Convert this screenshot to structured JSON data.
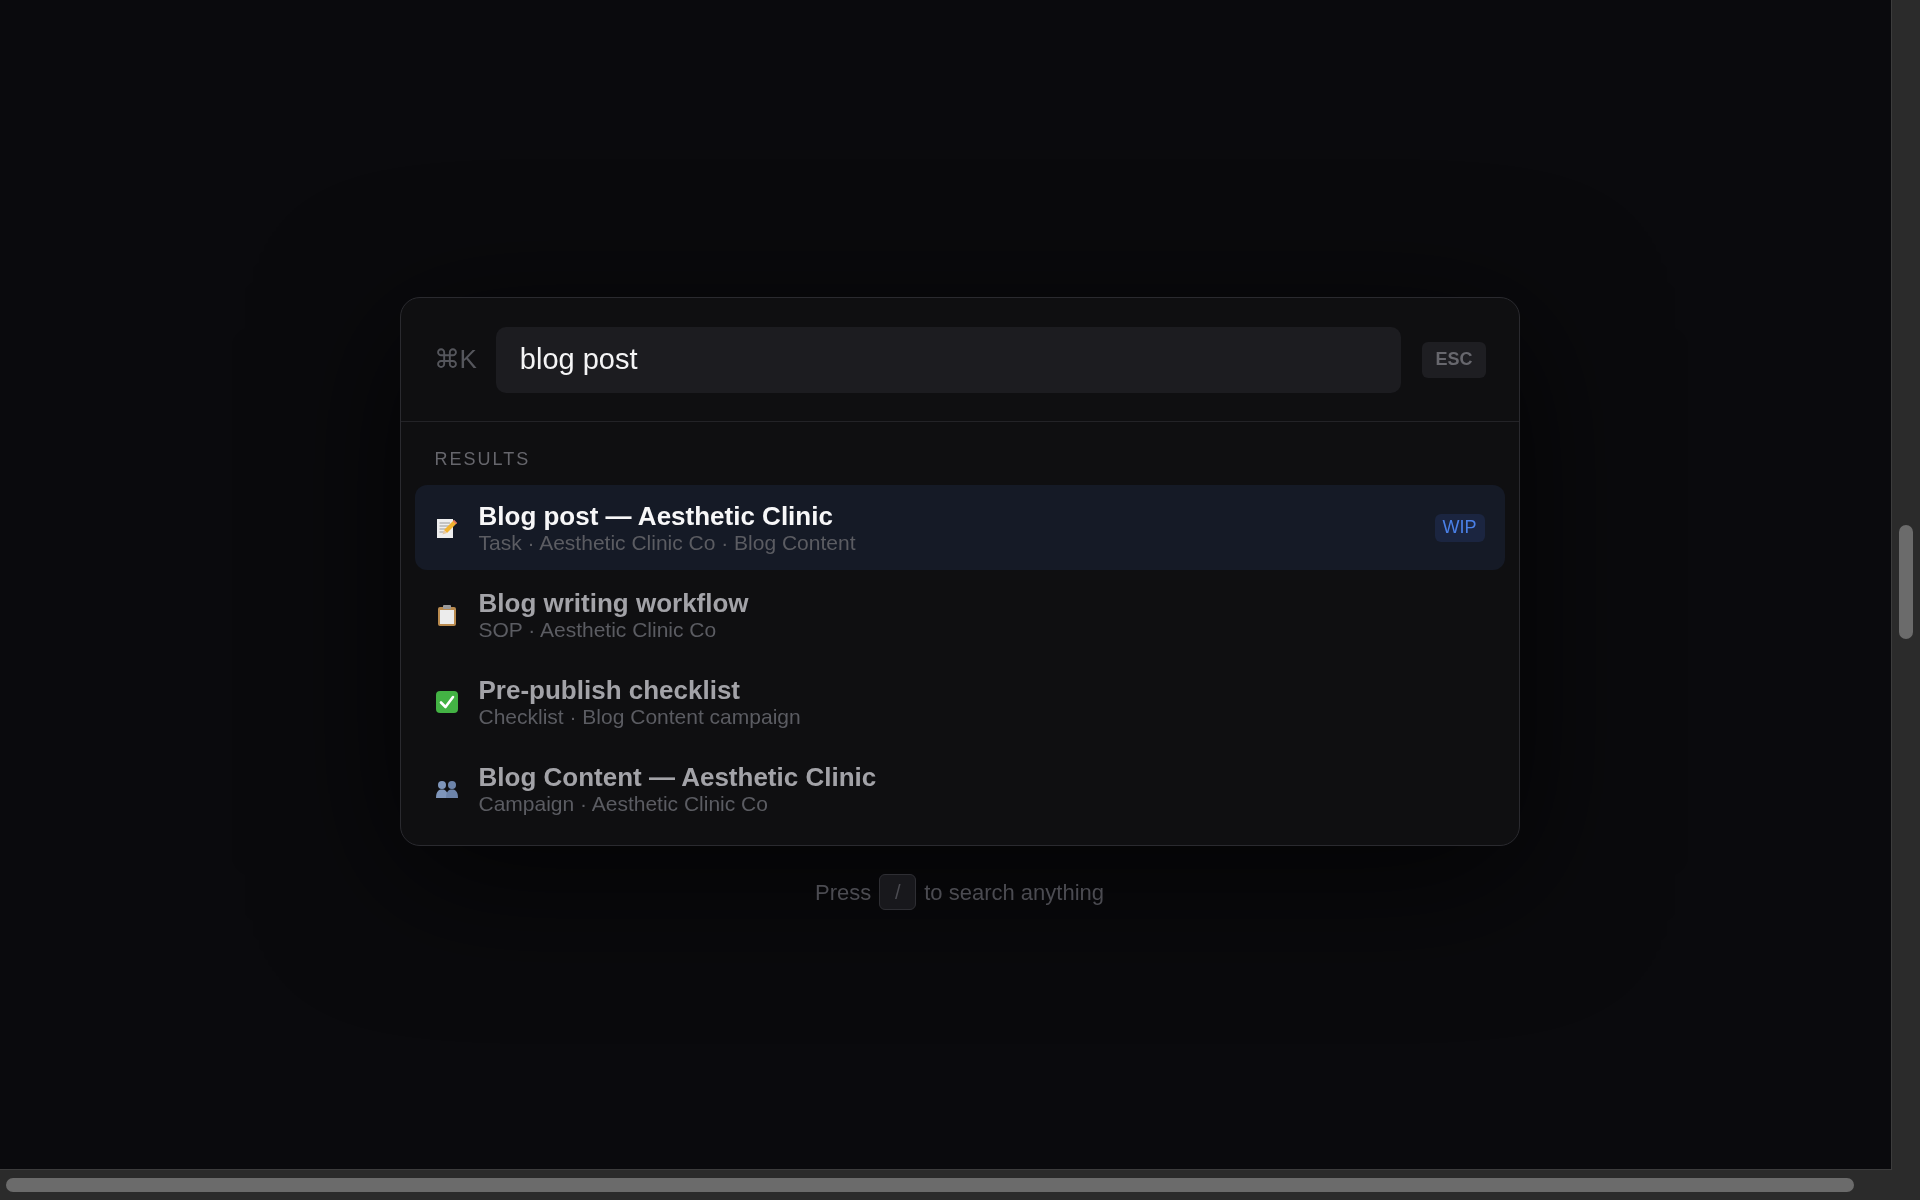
{
  "search": {
    "shortcut": "⌘K",
    "value": "blog post",
    "dismiss_key": "ESC"
  },
  "results_section": {
    "heading": "RESULTS",
    "items": [
      {
        "kind": "task",
        "title": "Blog post — Aesthetic Clinic",
        "subtitle": "Task · Aesthetic Clinic Co · Blog Content",
        "badge": "WIP",
        "selected": true
      },
      {
        "kind": "sop",
        "title": "Blog writing workflow",
        "subtitle": "SOP · Aesthetic Clinic Co",
        "selected": false
      },
      {
        "kind": "checklist",
        "title": "Pre-publish checklist",
        "subtitle": "Checklist · Blog Content campaign",
        "selected": false
      },
      {
        "kind": "campaign",
        "title": "Blog Content — Aesthetic Clinic",
        "subtitle": "Campaign · Aesthetic Clinic Co",
        "selected": false
      }
    ]
  },
  "footer_hint": {
    "before": "Press",
    "key": "/",
    "after": "to search anything"
  }
}
